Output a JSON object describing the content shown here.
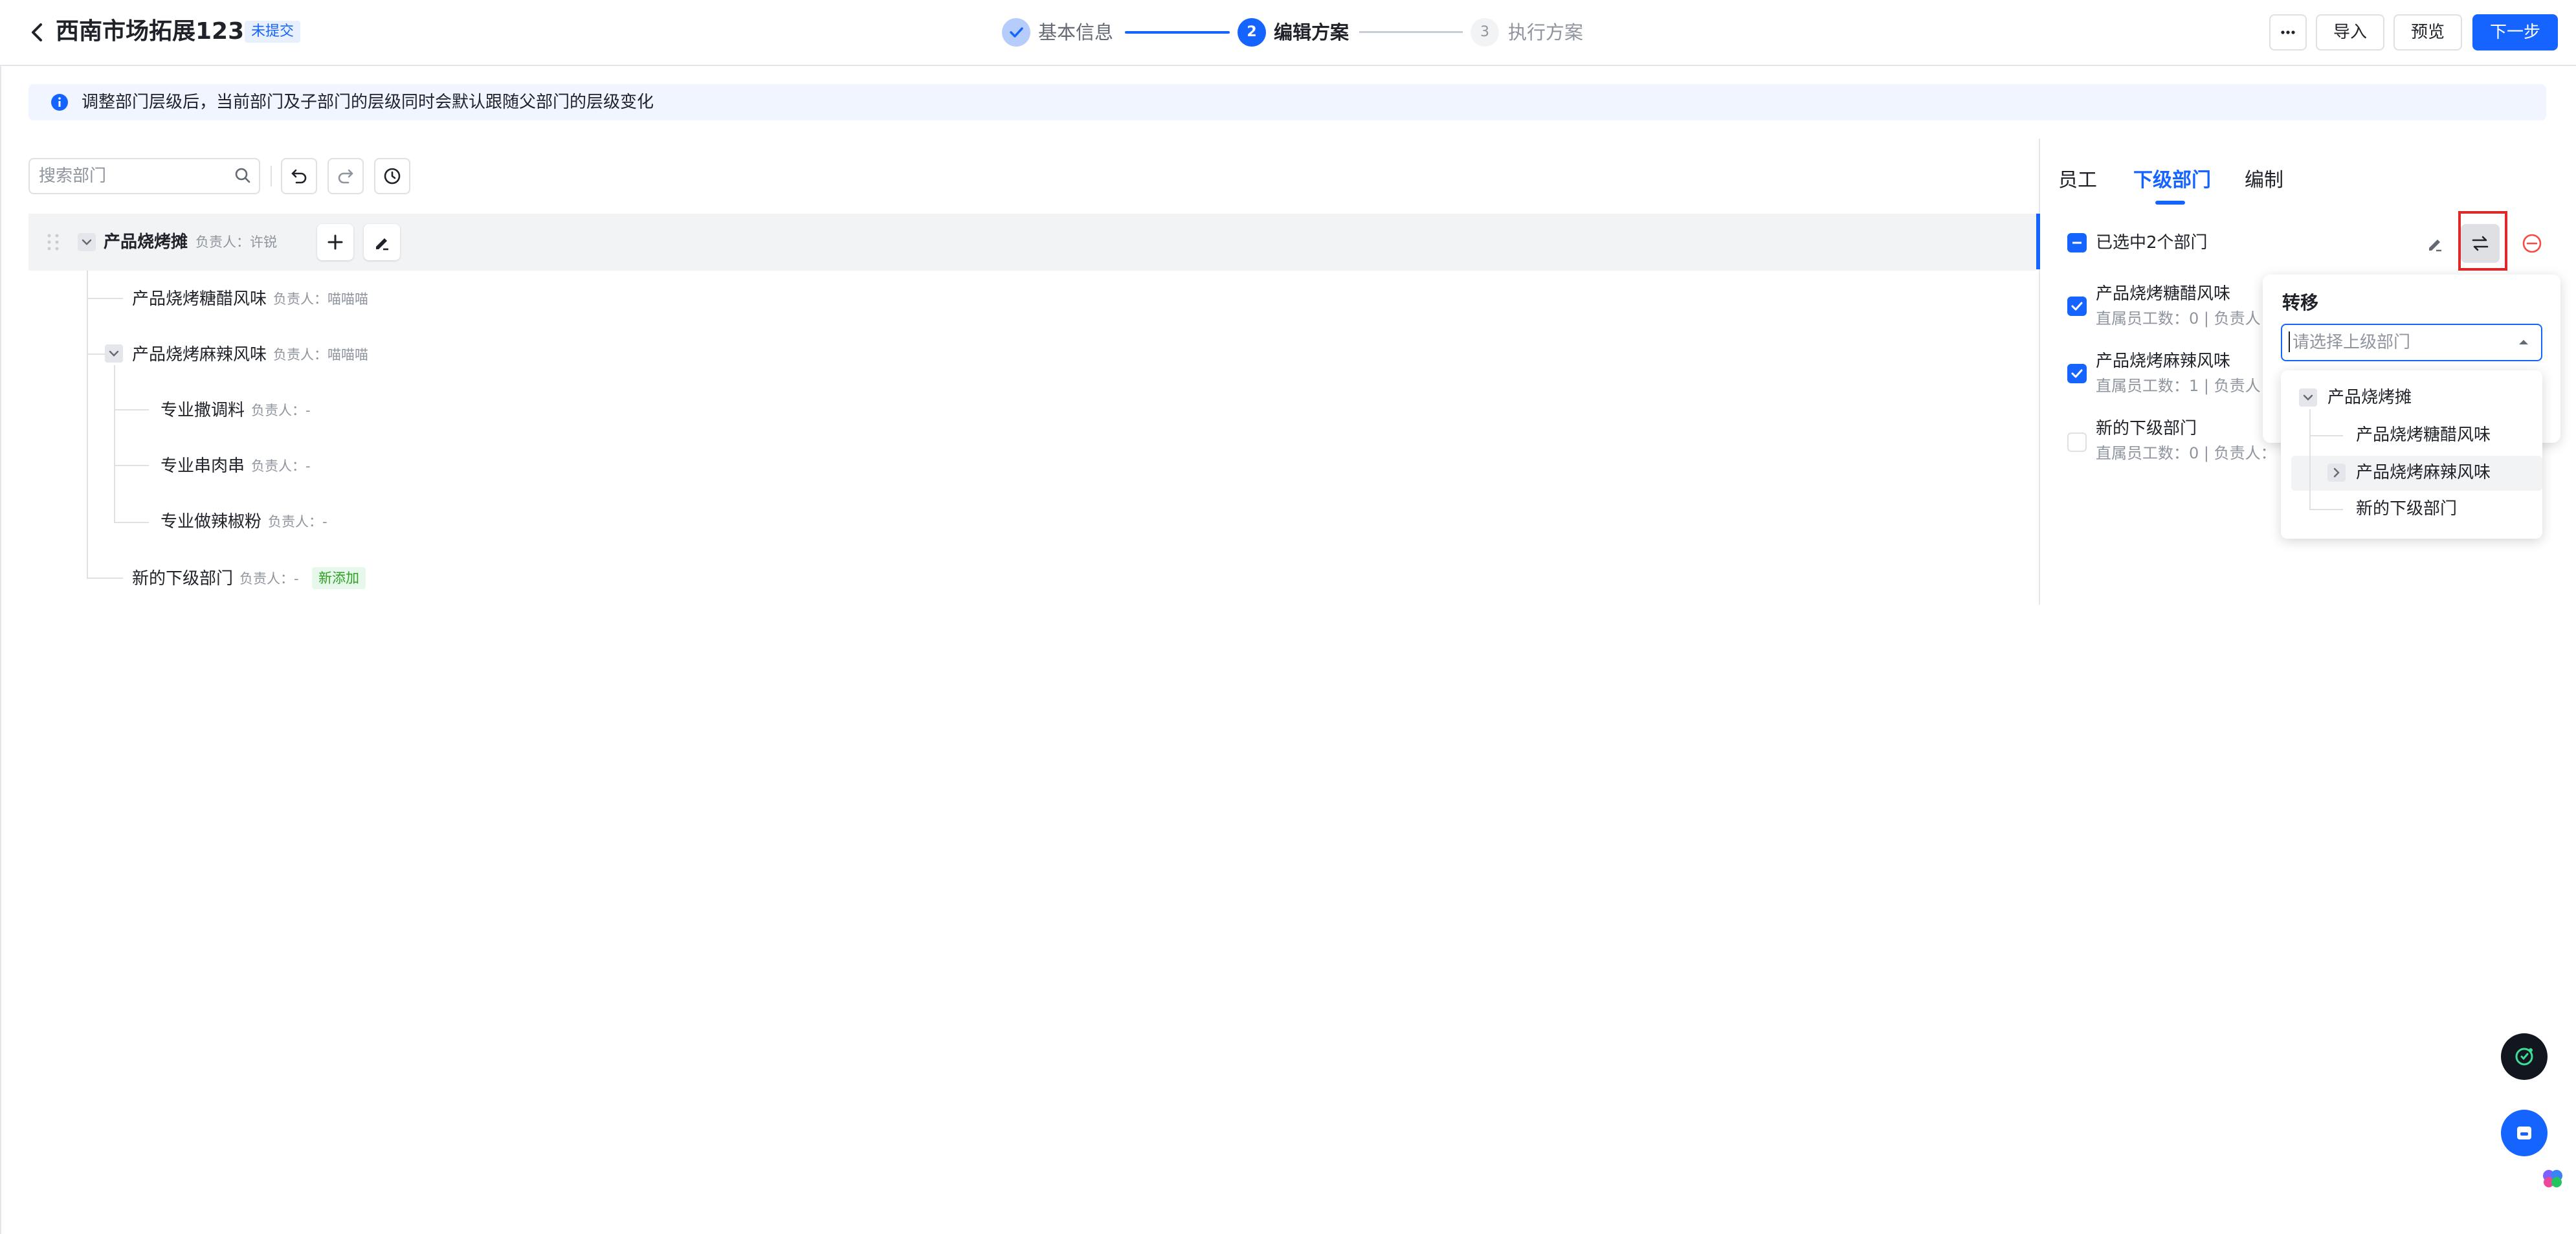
{
  "header": {
    "title": "西南市场拓展123",
    "status_badge": "未提交",
    "steps": [
      {
        "num": "✓",
        "label": "基本信息",
        "state": "done"
      },
      {
        "num": "2",
        "label": "编辑方案",
        "state": "active"
      },
      {
        "num": "3",
        "label": "执行方案",
        "state": "pending"
      }
    ],
    "more_icon": "more-horizontal-icon",
    "import_label": "导入",
    "preview_label": "预览",
    "next_label": "下一步"
  },
  "info": {
    "text": "调整部门层级后，当前部门及子部门的层级同时会默认跟随父部门的层级变化",
    "icon": "info-icon"
  },
  "toolbar": {
    "search_placeholder": "搜索部门",
    "icons": [
      "search-icon",
      "undo-icon",
      "redo-icon",
      "history-icon"
    ]
  },
  "tree": {
    "root": {
      "name": "产品烧烤摊",
      "lead": "负责人：许锐"
    },
    "children": [
      {
        "name": "产品烧烤糖醋风味",
        "lead": "负责人：喵喵喵"
      },
      {
        "name": "产品烧烤麻辣风味",
        "lead": "负责人：喵喵喵",
        "children": [
          {
            "name": "专业撒调料",
            "lead": "负责人：-"
          },
          {
            "name": "专业串肉串",
            "lead": "负责人：-"
          },
          {
            "name": "专业做辣椒粉",
            "lead": "负责人：-"
          }
        ]
      },
      {
        "name": "新的下级部门",
        "lead": "负责人：-",
        "tag": "新添加"
      }
    ]
  },
  "panel": {
    "tabs": [
      "员工",
      "下级部门",
      "编制"
    ],
    "active_tab": "下级部门",
    "selected_text": "已选中2个部门",
    "action_icons": [
      "edit-icon",
      "transfer-icon",
      "remove-icon"
    ],
    "items": [
      {
        "name": "产品烧烤糖醋风味",
        "meta": "直属员工数：0 | 负责人",
        "checked": true
      },
      {
        "name": "产品烧烤麻辣风味",
        "meta": "直属员工数：1 | 负责人",
        "checked": true
      },
      {
        "name": "新的下级部门",
        "meta": "直属员工数：0 | 负责人：",
        "checked": false
      }
    ]
  },
  "transfer": {
    "title": "转移",
    "placeholder": "请选择上级部门",
    "options": {
      "root": "产品烧烤摊",
      "items": [
        "产品烧烤糖醋风味",
        "产品烧烤麻辣风味",
        "新的下级部门"
      ],
      "hovered": "产品烧烤麻辣风味"
    }
  },
  "floating": [
    "ai-assistant-icon",
    "chat-icon",
    "brain-icon"
  ],
  "colors": {
    "accent": "#1664ff",
    "highlight": "#e02828",
    "new_tag": "#2ea121"
  }
}
